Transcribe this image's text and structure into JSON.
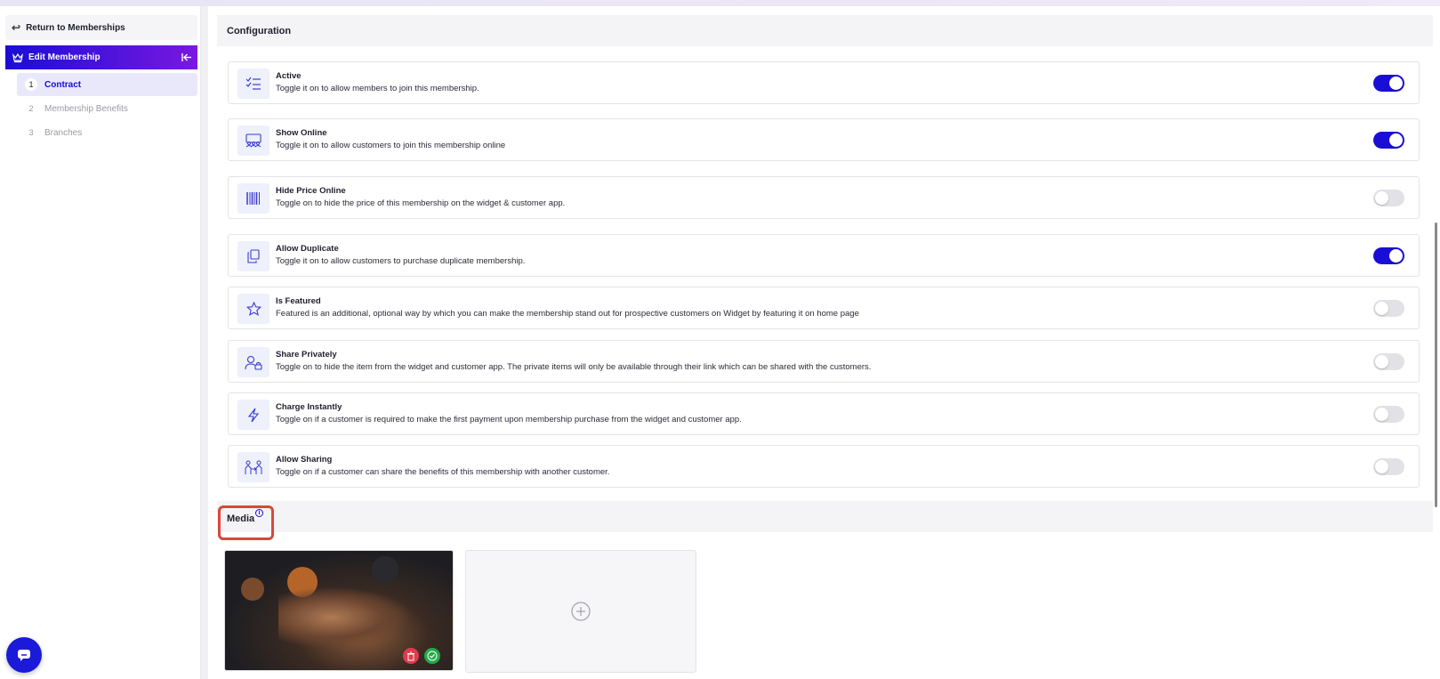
{
  "sidebar": {
    "return_label": "Return to Memberships",
    "edit_label": "Edit Membership",
    "steps": [
      {
        "num": "1",
        "label": "Contract",
        "active": true
      },
      {
        "num": "2",
        "label": "Membership Benefits",
        "active": false
      },
      {
        "num": "3",
        "label": "Branches",
        "active": false
      }
    ]
  },
  "configuration": {
    "title": "Configuration",
    "items": [
      {
        "title": "Active",
        "desc": "Toggle it on to allow members to join this membership.",
        "on": true,
        "icon": "checklist-icon"
      },
      {
        "title": "Show Online",
        "desc": "Toggle it on to allow customers to join this membership online",
        "on": true,
        "icon": "online-audience-icon"
      },
      {
        "title": "Hide Price Online",
        "desc": "Toggle on to hide the price of this membership on the widget & customer app.",
        "on": false,
        "icon": "barcode-icon"
      },
      {
        "title": "Allow Duplicate",
        "desc": "Toggle it on to allow customers to purchase duplicate membership.",
        "on": true,
        "icon": "duplicate-icon"
      },
      {
        "title": "Is Featured",
        "desc": "Featured is an additional, optional way by which you can make the membership stand out for prospective customers on Widget by featuring it on home page",
        "on": false,
        "icon": "star-icon"
      },
      {
        "title": "Share Privately",
        "desc": "Toggle on to hide the item from the widget and customer app. The private items will only be available through their link which can be shared with the customers.",
        "on": false,
        "icon": "user-lock-icon"
      },
      {
        "title": "Charge Instantly",
        "desc": "Toggle on if a customer is required to make the first payment upon membership purchase from the widget and customer app.",
        "on": false,
        "icon": "lightning-icon"
      },
      {
        "title": "Allow Sharing",
        "desc": "Toggle on if a customer can share the benefits of this membership with another customer.",
        "on": false,
        "icon": "people-sharing-icon"
      }
    ]
  },
  "media": {
    "title": "Media",
    "info": "i"
  },
  "colors": {
    "accent": "#1a0dd6",
    "highlight": "#d9483b",
    "delete": "#e23a4e",
    "confirm": "#25a84a"
  }
}
